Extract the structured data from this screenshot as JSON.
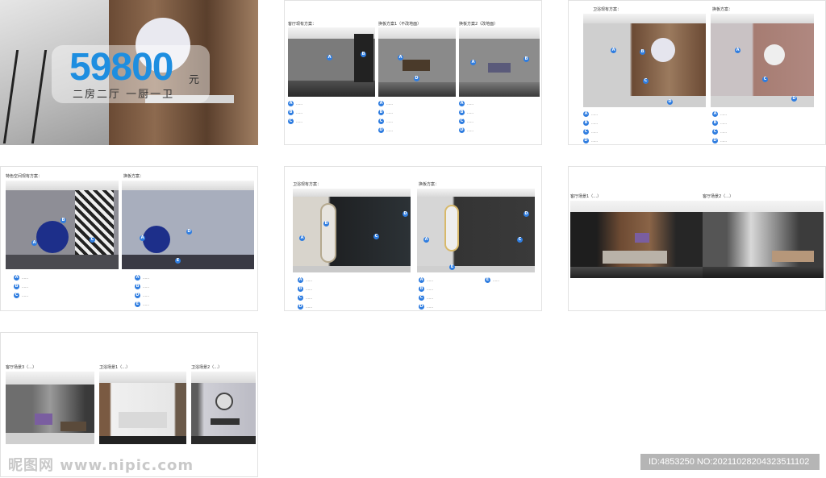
{
  "cover": {
    "price": "59800",
    "unit": "元",
    "layout": "二房二厅 一厨一卫"
  },
  "p2": {
    "c1": "客厅现有方案：",
    "c2": "换板方案1（不改地面）",
    "c3": "换板方案2（改地面）"
  },
  "p3": {
    "c1": "卫浴现有方案：",
    "c2": "换板方案："
  },
  "p4": {
    "c1": "特色空间现有方案：",
    "c2": "换板方案："
  },
  "p5": {
    "c1": "卫浴现有方案：",
    "c2": "换板方案："
  },
  "p6": {
    "c1": "客厅场景1（…）",
    "c2": "客厅场景2（…）"
  },
  "p7": {
    "c1": "客厅场景3（…）",
    "c2": "卫浴场景1（…）",
    "c3": "卫浴场景2（…）"
  },
  "footer": {
    "watermark": "昵图网 www.nipic.com",
    "id": "ID:4853250 NO:20211028204323511102"
  }
}
